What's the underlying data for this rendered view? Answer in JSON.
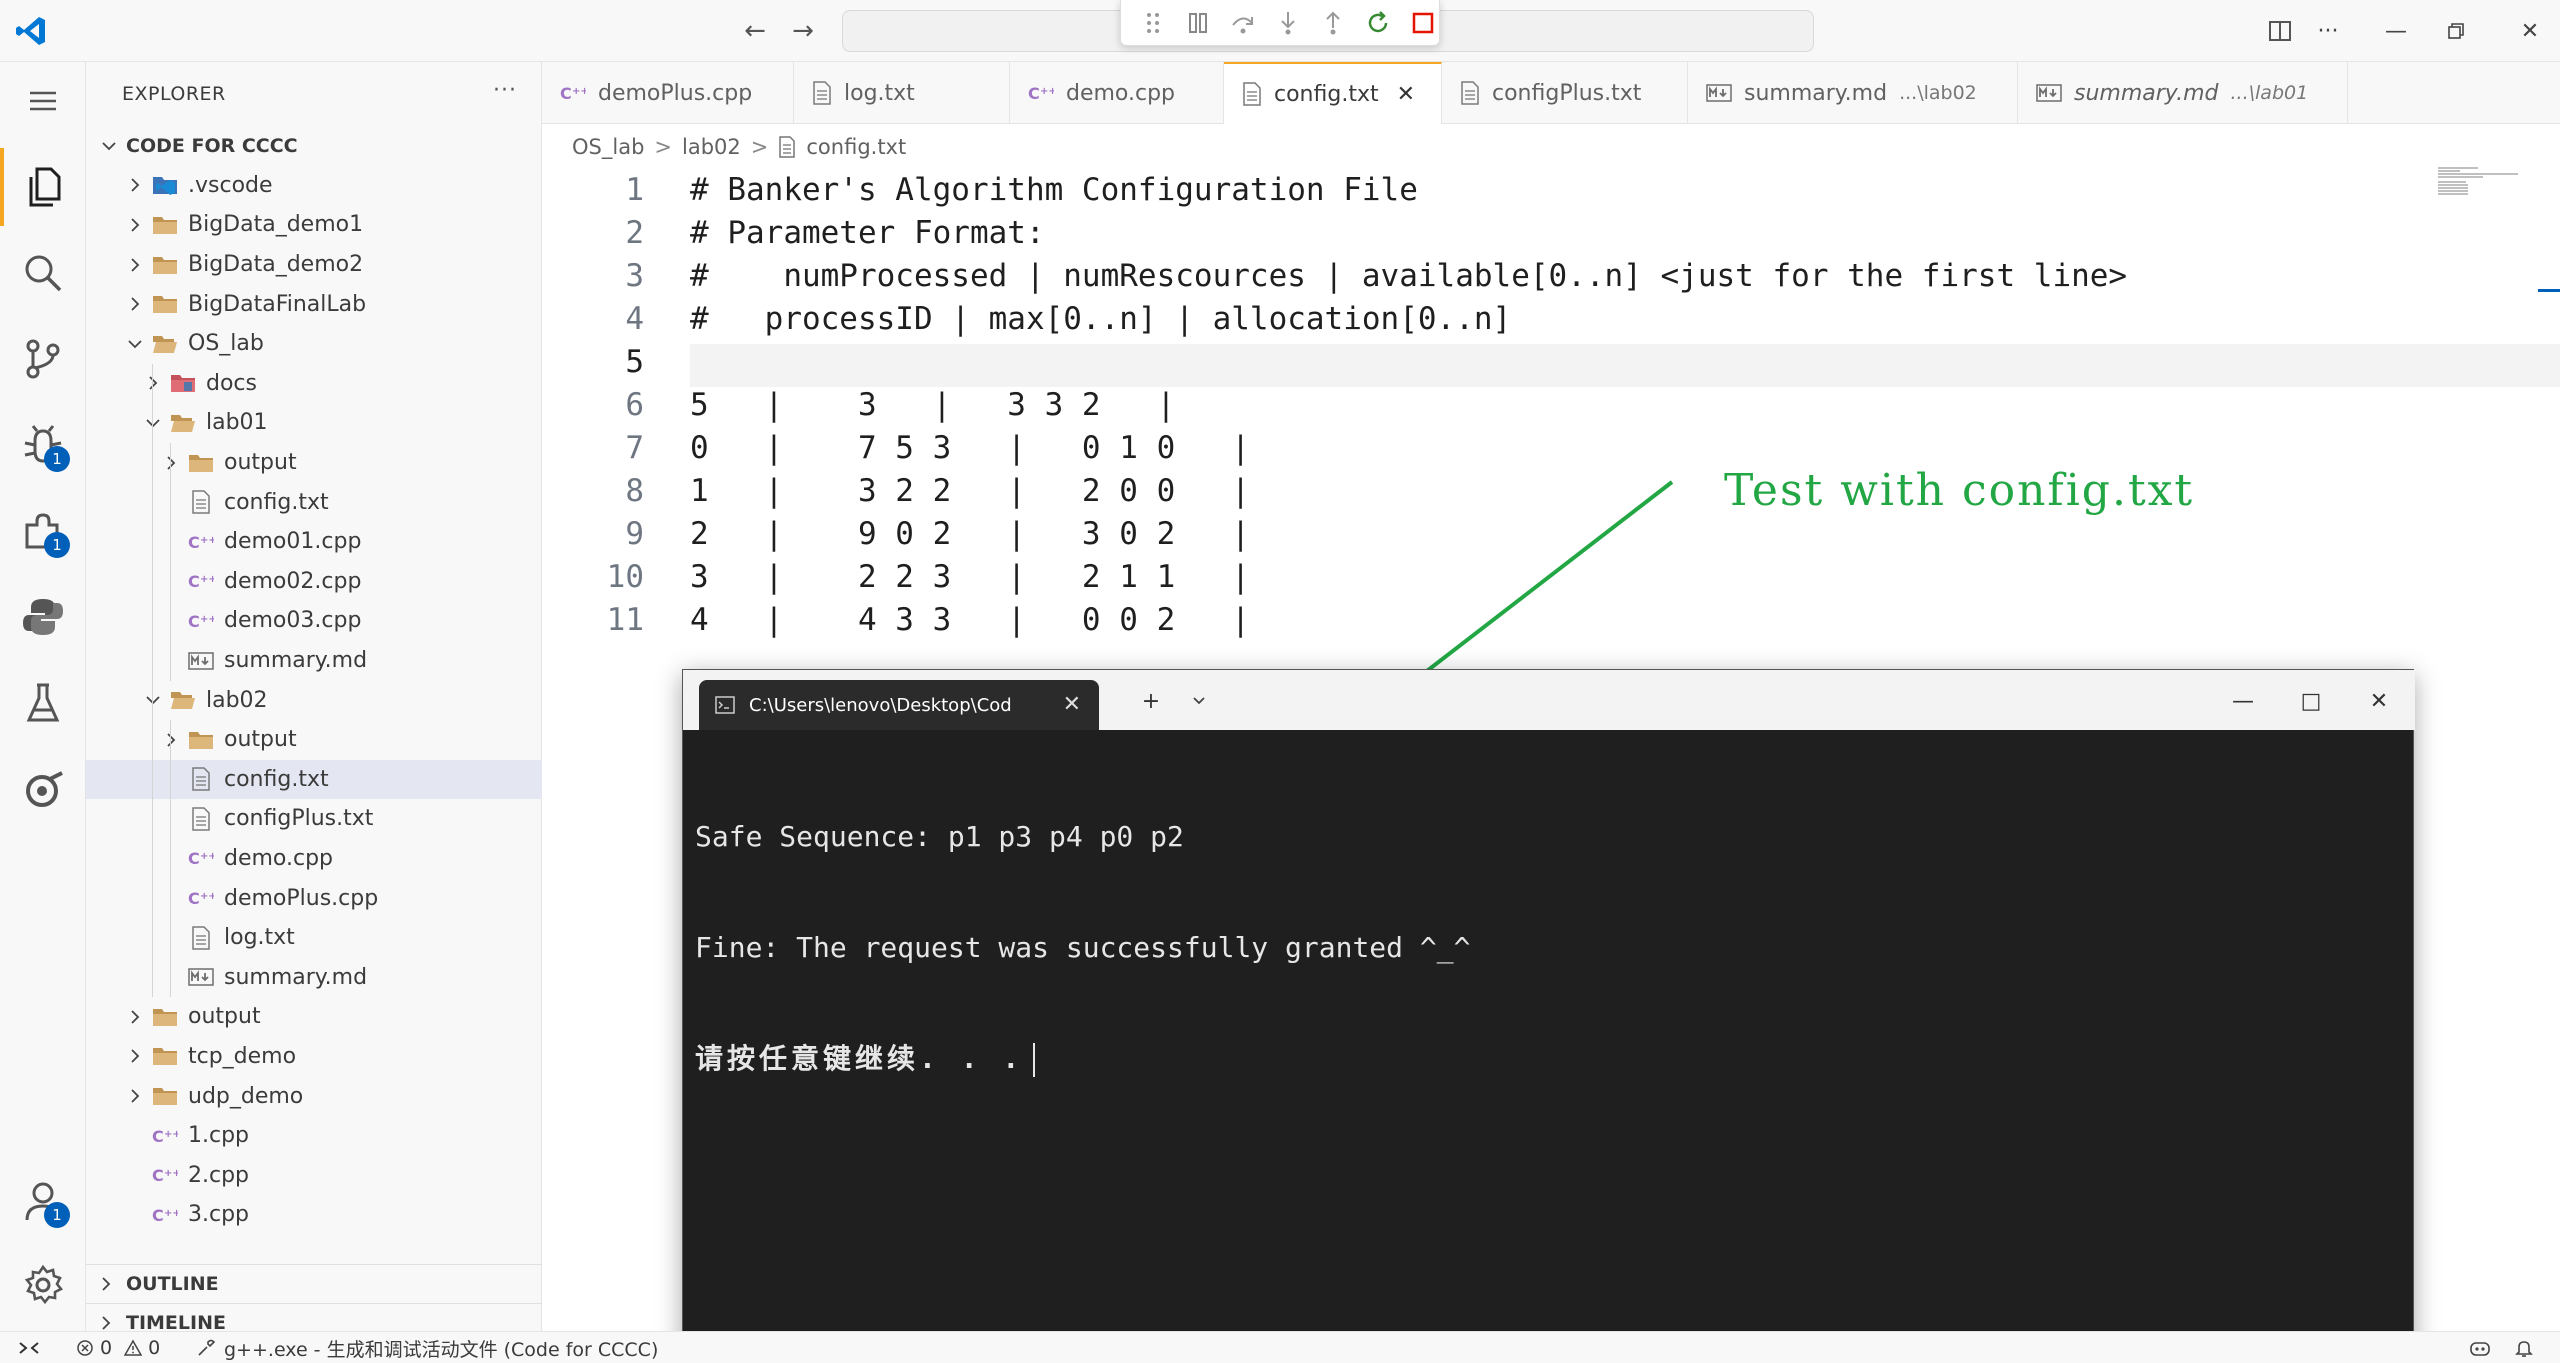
{
  "colors": {
    "accent_tab": "#f5a623",
    "badge": "#005fb8",
    "annotation_green": "#22a744",
    "cpp_icon": "#a074c4",
    "folder": "#dcb67a",
    "terminal_bg": "#1f1f1f"
  },
  "titlebar": {
    "back_icon": "arrow-left-icon",
    "forward_icon": "arrow-right-icon",
    "search_placeholder": ""
  },
  "activity": {
    "debug_badge": "1",
    "extensions_badge": "1",
    "accounts_badge": "1"
  },
  "sidebar": {
    "title": "EXPLORER",
    "more": "···",
    "root": "CODE FOR CCCC",
    "items": [
      {
        "label": ".vscode",
        "depth": 1,
        "type": "vscode",
        "chevron": "right"
      },
      {
        "label": "BigData_demo1",
        "depth": 1,
        "type": "folder",
        "chevron": "right"
      },
      {
        "label": "BigData_demo2",
        "depth": 1,
        "type": "folder",
        "chevron": "right"
      },
      {
        "label": "BigDataFinalLab",
        "depth": 1,
        "type": "folder",
        "chevron": "right"
      },
      {
        "label": "OS_lab",
        "depth": 1,
        "type": "folder-open",
        "chevron": "down"
      },
      {
        "label": "docs",
        "depth": 2,
        "type": "docs",
        "chevron": "right"
      },
      {
        "label": "lab01",
        "depth": 2,
        "type": "folder-open",
        "chevron": "down"
      },
      {
        "label": "output",
        "depth": 3,
        "type": "folder",
        "chevron": "right"
      },
      {
        "label": "config.txt",
        "depth": 3,
        "type": "txt",
        "chevron": ""
      },
      {
        "label": "demo01.cpp",
        "depth": 3,
        "type": "cpp",
        "chevron": ""
      },
      {
        "label": "demo02.cpp",
        "depth": 3,
        "type": "cpp",
        "chevron": ""
      },
      {
        "label": "demo03.cpp",
        "depth": 3,
        "type": "cpp",
        "chevron": ""
      },
      {
        "label": "summary.md",
        "depth": 3,
        "type": "md",
        "chevron": ""
      },
      {
        "label": "lab02",
        "depth": 2,
        "type": "folder-open",
        "chevron": "down"
      },
      {
        "label": "output",
        "depth": 3,
        "type": "folder",
        "chevron": "right"
      },
      {
        "label": "config.txt",
        "depth": 3,
        "type": "txt",
        "chevron": "",
        "selected": true
      },
      {
        "label": "configPlus.txt",
        "depth": 3,
        "type": "txt",
        "chevron": ""
      },
      {
        "label": "demo.cpp",
        "depth": 3,
        "type": "cpp",
        "chevron": ""
      },
      {
        "label": "demoPlus.cpp",
        "depth": 3,
        "type": "cpp",
        "chevron": ""
      },
      {
        "label": "log.txt",
        "depth": 3,
        "type": "txt",
        "chevron": ""
      },
      {
        "label": "summary.md",
        "depth": 3,
        "type": "md",
        "chevron": ""
      },
      {
        "label": "output",
        "depth": 1,
        "type": "folder",
        "chevron": "right"
      },
      {
        "label": "tcp_demo",
        "depth": 1,
        "type": "folder",
        "chevron": "right"
      },
      {
        "label": "udp_demo",
        "depth": 1,
        "type": "folder",
        "chevron": "right"
      },
      {
        "label": "1.cpp",
        "depth": 1,
        "type": "cpp",
        "chevron": ""
      },
      {
        "label": "2.cpp",
        "depth": 1,
        "type": "cpp",
        "chevron": ""
      },
      {
        "label": "3.cpp",
        "depth": 1,
        "type": "cpp",
        "chevron": ""
      }
    ],
    "outline": "OUTLINE",
    "timeline": "TIMELINE"
  },
  "tabs": [
    {
      "label": "demoPlus.cpp",
      "type": "cpp",
      "desc": "",
      "width": 252
    },
    {
      "label": "log.txt",
      "type": "txt",
      "desc": "",
      "width": 216
    },
    {
      "label": "demo.cpp",
      "type": "cpp",
      "desc": "",
      "width": 214
    },
    {
      "label": "config.txt",
      "type": "txt",
      "desc": "",
      "active": true,
      "close": "✕",
      "width": 218
    },
    {
      "label": "configPlus.txt",
      "type": "txt",
      "desc": "",
      "width": 246
    },
    {
      "label": "summary.md",
      "type": "md",
      "desc": "...\\lab02",
      "width": 330
    },
    {
      "label": "summary.md",
      "type": "md",
      "desc": "...\\lab01",
      "width": 330,
      "italic": true
    }
  ],
  "breadcrumb": {
    "p1": "OS_lab",
    "p2": "lab02",
    "p3": "config.txt",
    "sep": ">"
  },
  "editor": {
    "lines": [
      {
        "n": "1",
        "text": "# Banker's Algorithm Configuration File"
      },
      {
        "n": "2",
        "text": "# Parameter Format:"
      },
      {
        "n": "3",
        "text": "#    numProcessed | numRescources | available[0..n] <just for the first line>"
      },
      {
        "n": "4",
        "text": "#   processID | max[0..n] | allocation[0..n]"
      },
      {
        "n": "5",
        "text": "",
        "current": true
      },
      {
        "n": "6",
        "text": "5   |    3   |   3 3 2   |"
      },
      {
        "n": "7",
        "text": "0   |    7 5 3   |   0 1 0   |"
      },
      {
        "n": "8",
        "text": "1   |    3 2 2   |   2 0 0   |"
      },
      {
        "n": "9",
        "text": "2   |    9 0 2   |   3 0 2   |"
      },
      {
        "n": "10",
        "text": "3   |    2 2 3   |   2 1 1   |"
      },
      {
        "n": "11",
        "text": "4   |    4 3 3   |   0 0 2   |"
      }
    ]
  },
  "annotation": {
    "text": "Test with config.txt"
  },
  "terminal": {
    "tab_title": "C:\\Users\\lenovo\\Desktop\\Cod",
    "tab_close": "✕",
    "new_tab": "+",
    "dropdown": "⌄",
    "minimize": "—",
    "maximize": "□",
    "close": "✕",
    "output": [
      "Safe Sequence: p1 p3 p4 p0 p2",
      "Fine: The request was successfully granted ^_^"
    ],
    "prompt": "请按任意键继续. . ."
  },
  "statusbar": {
    "errors": "0",
    "warnings": "0",
    "task": "g++.exe - 生成和调试活动文件 (Code for CCCC)"
  }
}
